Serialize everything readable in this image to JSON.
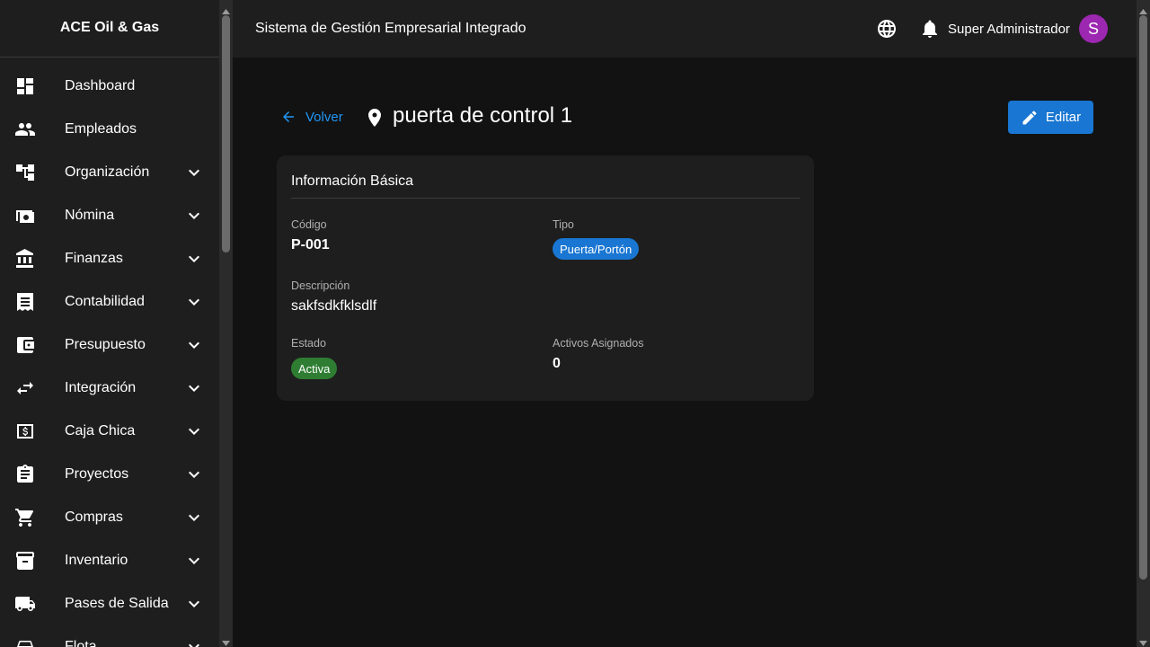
{
  "sidebar": {
    "brand": "ACE Oil & Gas",
    "items": [
      {
        "label": "Dashboard",
        "icon": "dashboard-icon",
        "expandable": false
      },
      {
        "label": "Empleados",
        "icon": "people-icon",
        "expandable": false
      },
      {
        "label": "Organización",
        "icon": "org-chart-icon",
        "expandable": true
      },
      {
        "label": "Nómina",
        "icon": "payroll-icon",
        "expandable": true
      },
      {
        "label": "Finanzas",
        "icon": "bank-icon",
        "expandable": true
      },
      {
        "label": "Contabilidad",
        "icon": "receipt-icon",
        "expandable": true
      },
      {
        "label": "Presupuesto",
        "icon": "wallet-icon",
        "expandable": true
      },
      {
        "label": "Integración",
        "icon": "swap-icon",
        "expandable": true
      },
      {
        "label": "Caja Chica",
        "icon": "cash-box-icon",
        "expandable": true
      },
      {
        "label": "Proyectos",
        "icon": "clipboard-icon",
        "expandable": true
      },
      {
        "label": "Compras",
        "icon": "cart-icon",
        "expandable": true
      },
      {
        "label": "Inventario",
        "icon": "archive-icon",
        "expandable": true
      },
      {
        "label": "Pases de Salida",
        "icon": "truck-icon",
        "expandable": true
      },
      {
        "label": "Flota",
        "icon": "car-icon",
        "expandable": true
      }
    ]
  },
  "header": {
    "title": "Sistema de Gestión Empresarial Integrado",
    "user_name": "Super Administrador",
    "avatar_initial": "S"
  },
  "page": {
    "back_label": "Volver",
    "title": "puerta de control 1",
    "edit_label": "Editar"
  },
  "card": {
    "title": "Información Básica",
    "code_label": "Código",
    "code_value": "P-001",
    "type_label": "Tipo",
    "type_value": "Puerta/Portón",
    "description_label": "Descripción",
    "description_value": "sakfsdkfklsdlf",
    "status_label": "Estado",
    "status_value": "Activa",
    "assets_label": "Activos Asignados",
    "assets_value": "0"
  },
  "colors": {
    "primary": "#1976d2",
    "link": "#2196f3",
    "success": "#2e7d32",
    "avatar": "#9c27b0"
  }
}
